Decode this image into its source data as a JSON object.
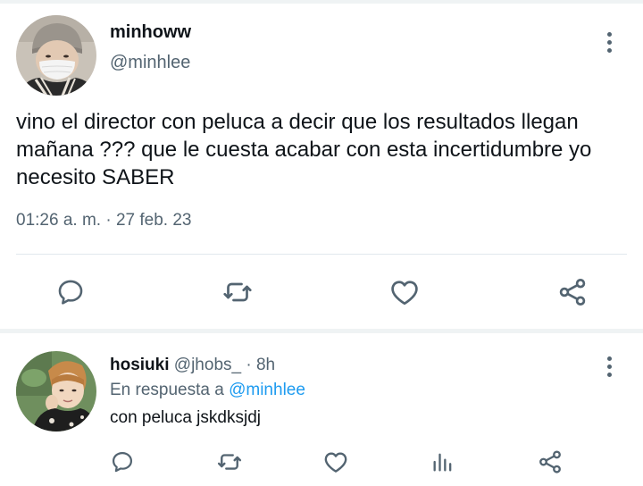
{
  "tweet": {
    "author_name": "minhoww",
    "author_handle": "@minhlee",
    "text": "vino el director con peluca a decir que los resultados llegan mañana ??? que le cuesta acabar con esta incertidumbre yo necesito SABER",
    "time": "01:26 a. m.",
    "meta_separator": " · ",
    "date": "27 feb. 23",
    "avatar_icon": "avatar-photo-masked-person",
    "more_icon": "more-vertical-icon",
    "actions": [
      "reply-icon",
      "retweet-icon",
      "like-icon",
      "share-icon"
    ]
  },
  "reply": {
    "author_name": "hosiuki",
    "author_handle": "@jhobs_",
    "dot": " · ",
    "time": "8h",
    "reply_to_label": "En respuesta a ",
    "reply_to_handle": "@minhlee",
    "text": "con peluca jskdksjdj",
    "avatar_icon": "avatar-photo-person",
    "more_icon": "more-vertical-icon",
    "actions": [
      "reply-icon",
      "retweet-icon",
      "like-icon",
      "views-icon",
      "share-icon"
    ]
  },
  "colors": {
    "text_primary": "#0f1419",
    "text_secondary": "#536471",
    "link": "#1d9bf0",
    "divider": "#e1e8ed",
    "separator_bg": "#eff3f4",
    "icon": "#536471"
  }
}
